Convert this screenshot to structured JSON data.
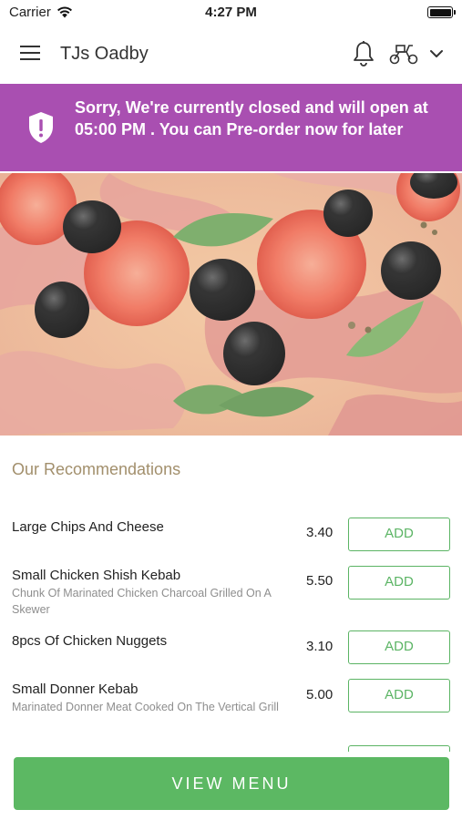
{
  "status_bar": {
    "carrier": "Carrier",
    "time": "4:27 PM"
  },
  "header": {
    "title": "TJs Oadby",
    "icons": [
      "menu-icon",
      "bell-icon",
      "scooter-icon",
      "chevron-down-icon"
    ]
  },
  "banner": {
    "message": "Sorry, We're currently closed and will open at 05:00 PM . You can Pre-order now for later",
    "icon": "shield-alert-icon",
    "color": "#a94fb1"
  },
  "hero": {
    "image": "pizza-photo"
  },
  "recommendations": {
    "title": "Our Recommendations",
    "items": [
      {
        "name": "Large Chips And Cheese",
        "description": "",
        "price": "3.40",
        "button": "ADD"
      },
      {
        "name": "Small Chicken Shish Kebab",
        "description": "Chunk Of Marinated Chicken Charcoal Grilled On A Skewer",
        "price": "5.50",
        "button": "ADD"
      },
      {
        "name": "8pcs Of Chicken Nuggets",
        "description": "",
        "price": "3.10",
        "button": "ADD"
      },
      {
        "name": "Small Donner Kebab",
        "description": "Marinated Donner Meat Cooked On The Vertical Grill",
        "price": "5.00",
        "button": "ADD"
      }
    ]
  },
  "footer": {
    "view_menu_label": "VIEW MENU",
    "accent": "#5cb863"
  }
}
